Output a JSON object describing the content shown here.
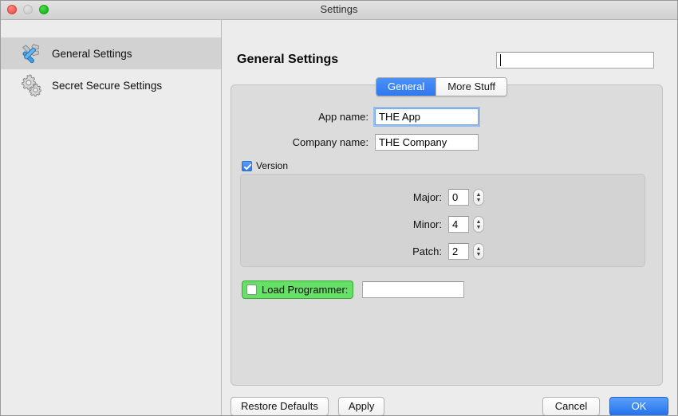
{
  "window": {
    "title": "Settings",
    "traffic_lights": [
      "close-button",
      "minimize-button",
      "maximize-button"
    ]
  },
  "sidebar": {
    "items": [
      {
        "label": "General Settings",
        "icon": "tools-icon",
        "selected": true
      },
      {
        "label": "Secret Secure Settings",
        "icon": "gears-icon",
        "selected": false
      }
    ]
  },
  "header": {
    "title": "General Settings",
    "search": {
      "value": "",
      "placeholder": ""
    }
  },
  "tabs": [
    {
      "label": "General",
      "active": true
    },
    {
      "label": "More Stuff",
      "active": false
    }
  ],
  "form": {
    "app_name": {
      "label": "App name:",
      "value": "THE App",
      "focused": true
    },
    "company_name": {
      "label": "Company name:",
      "value": "THE Company",
      "focused": false
    },
    "version": {
      "label": "Version",
      "checked": true,
      "fields": [
        {
          "label": "Major:",
          "value": "0"
        },
        {
          "label": "Minor:",
          "value": "4"
        },
        {
          "label": "Patch:",
          "value": "2"
        }
      ]
    },
    "load_programmer": {
      "label": "Load Programmer:",
      "checked": false,
      "highlight_color": "#66e066",
      "path_value": "",
      "path_placeholder": ""
    }
  },
  "buttons": {
    "restore_defaults": "Restore Defaults",
    "apply": "Apply",
    "cancel": "Cancel",
    "ok": "OK"
  },
  "colors": {
    "accent_blue": "#2f78ef",
    "highlight_green": "#66e066",
    "window_bg": "#ececec",
    "panel_bg": "#dcdcdc"
  },
  "stepper_glyphs": {
    "up": "▲",
    "down": "▼"
  }
}
